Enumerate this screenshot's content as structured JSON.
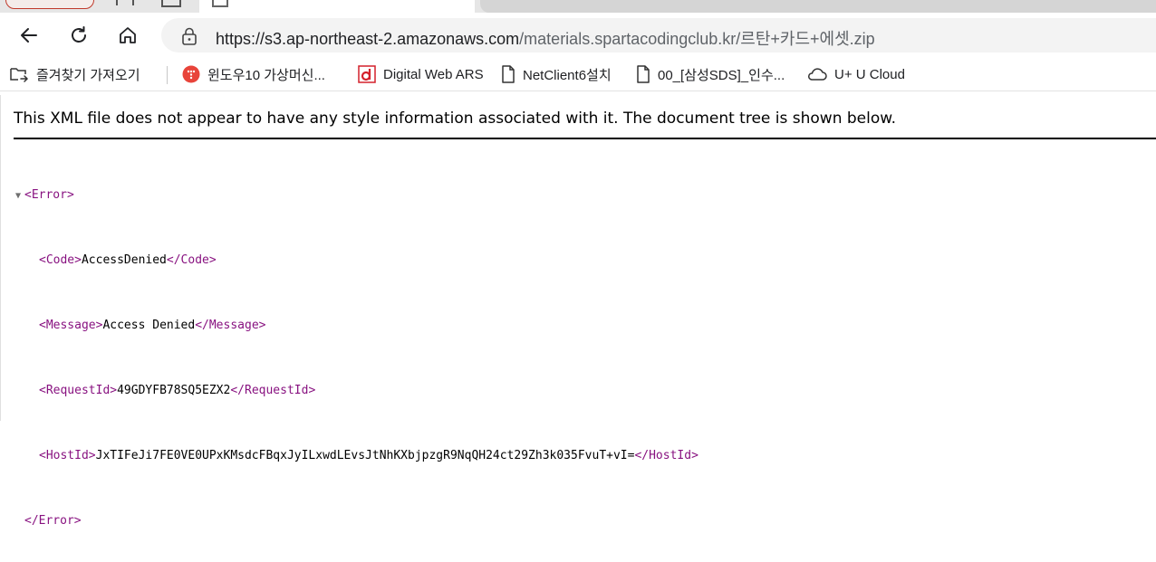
{
  "browser": {
    "address_bar": {
      "url_host": "https://s3.ap-northeast-2.amazonaws.com",
      "url_path": "/materials.spartacodingclub.kr/르탄+카드+에셋.zip"
    },
    "bookmarks": [
      {
        "label": "즐겨찾기 가져오기",
        "icon": "import-favorites-icon"
      },
      {
        "label": "윈도우10 가상머신...",
        "icon": "site-icon-red"
      },
      {
        "label": "Digital Web ARS",
        "icon": "d-logo-icon"
      },
      {
        "label": "NetClient6설치",
        "icon": "page-icon"
      },
      {
        "label": "00_[삼성SDS]_인수...",
        "icon": "page-icon"
      },
      {
        "label": "U+ U Cloud",
        "icon": "cloud-icon"
      }
    ]
  },
  "document": {
    "banner": "This XML file does not appear to have any style information associated with it. The document tree is shown below.",
    "root_tag": "Error",
    "elements": [
      {
        "tag": "Code",
        "value": "AccessDenied"
      },
      {
        "tag": "Message",
        "value": "Access Denied"
      },
      {
        "tag": "RequestId",
        "value": "49GDYFB78SQ5EZX2"
      },
      {
        "tag": "HostId",
        "value": "JxTIFeJi7FE0VE0UPxKMsdcFBqxJyILxwdLEvsJtNhKXbjpzgR9NqQH24ct29Zh3k035FvuT+vI="
      }
    ]
  }
}
